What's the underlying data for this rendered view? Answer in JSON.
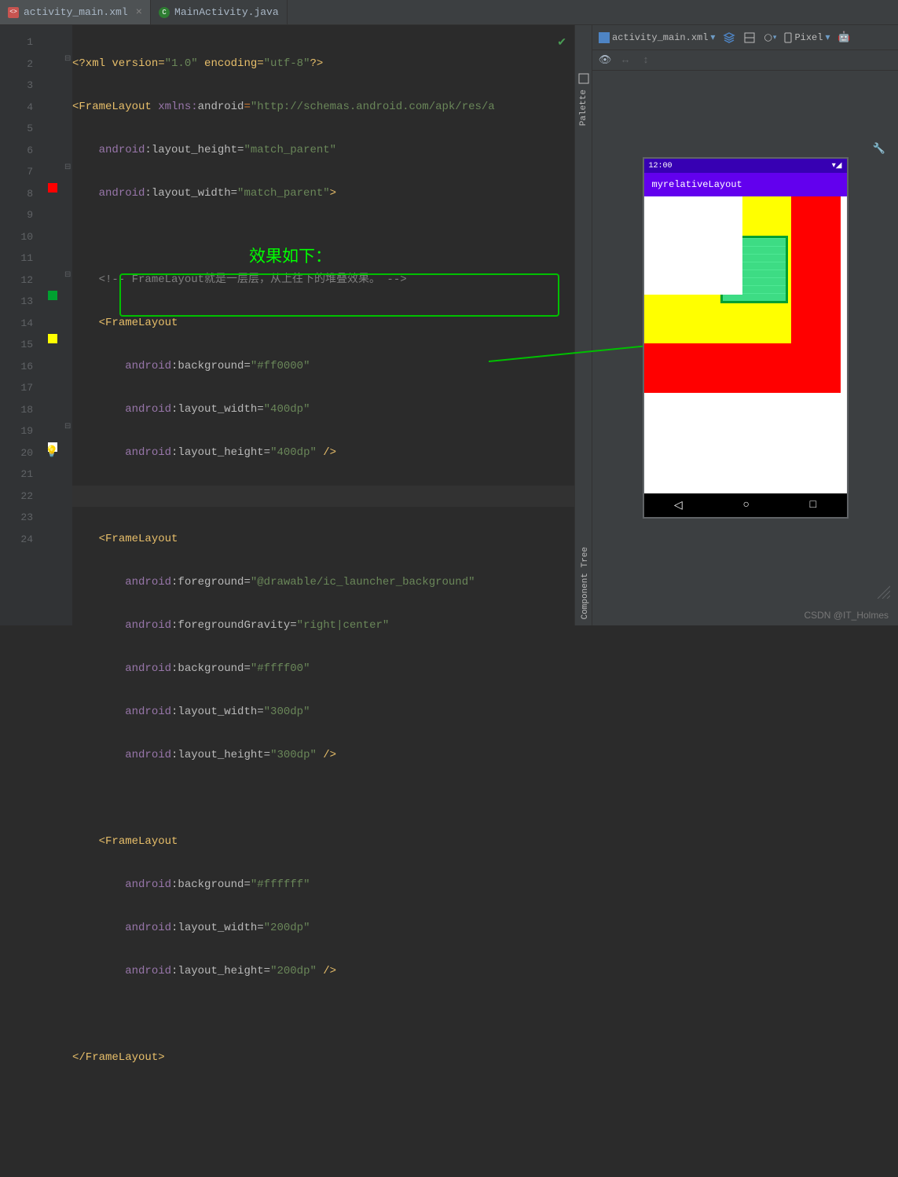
{
  "tabs": [
    {
      "label": "activity_main.xml",
      "active": true,
      "icon": "xml"
    },
    {
      "label": "MainActivity.java",
      "active": false,
      "icon": "java"
    }
  ],
  "gutter_lines": [
    "1",
    "2",
    "3",
    "4",
    "5",
    "6",
    "7",
    "8",
    "9",
    "10",
    "11",
    "12",
    "13",
    "14",
    "15",
    "16",
    "17",
    "18",
    "19",
    "20",
    "21",
    "22",
    "23",
    "24"
  ],
  "overlay_label": "效果如下：",
  "code": {
    "l1_decl": "<?xml version=",
    "l1_ver": "\"1.0\"",
    "l1_enc_k": " encoding=",
    "l1_enc_v": "\"utf-8\"",
    "l1_end": "?>",
    "l2_open": "<FrameLayout ",
    "l2_ns": "xmlns:",
    "l2_ns2": "android",
    "l2_eq": "=",
    "l2_url": "\"http://schemas.android.com/apk/res/a",
    "l3_ns": "android",
    "l3_attr": ":layout_height=",
    "l3_val": "\"match_parent\"",
    "l4_ns": "android",
    "l4_attr": ":layout_width=",
    "l4_val": "\"match_parent\"",
    "l4_close": ">",
    "l6_comment": "<!-- FrameLayout就是一层层，从上往下的堆叠效果。 -->",
    "l7_tag": "<FrameLayout",
    "l8_ns": "android",
    "l8_attr": ":background=",
    "l8_val": "\"#ff0000\"",
    "l9_ns": "android",
    "l9_attr": ":layout_width=",
    "l9_val": "\"400dp\"",
    "l10_ns": "android",
    "l10_attr": ":layout_height=",
    "l10_val": "\"400dp\"",
    "l10_close": " />",
    "l12_tag": "<FrameLayout",
    "l13_ns": "android",
    "l13_attr": ":foreground=",
    "l13_val": "\"@drawable/ic_launcher_background\"",
    "l14_ns": "android",
    "l14_attr": ":foregroundGravity=",
    "l14_val": "\"right|center\"",
    "l15_ns": "android",
    "l15_attr": ":background=",
    "l15_val": "\"#ffff00\"",
    "l16_ns": "android",
    "l16_attr": ":layout_width=",
    "l16_val": "\"300dp\"",
    "l17_ns": "android",
    "l17_attr": ":layout_height=",
    "l17_val": "\"300dp\"",
    "l17_close": " />",
    "l19_tag": "<FrameLayout",
    "l20_ns": "android",
    "l20_attr": ":background=",
    "l20_val": "\"#ffffff\"",
    "l21_ns": "android",
    "l21_attr": ":layout_width=",
    "l21_val": "\"200dp\"",
    "l22_ns": "android",
    "l22_attr": ":layout_height=",
    "l22_val": "\"200dp\"",
    "l22_close": " />",
    "l24_close": "</FrameLayout>"
  },
  "preview": {
    "filename": "activity_main.xml",
    "device": "Pixel",
    "status_time": "12:00",
    "app_title": "myrelativeLayout",
    "colors": {
      "red": "#ff0000",
      "yellow": "#ffff00",
      "white": "#ffffff"
    }
  },
  "sidebar": {
    "palette": "Palette",
    "component_tree": "Component Tree"
  },
  "watermark": "CSDN @IT_Holmes"
}
